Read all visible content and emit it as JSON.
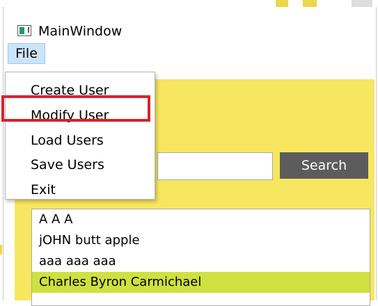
{
  "window": {
    "title": "MainWindow"
  },
  "menubar": {
    "file_label": "File"
  },
  "file_menu": {
    "items": [
      {
        "label": "Create User"
      },
      {
        "label": "Modify User"
      },
      {
        "label": "Load Users"
      },
      {
        "label": "Save Users"
      },
      {
        "label": "Exit"
      }
    ],
    "highlighted_item": "Modify User"
  },
  "search": {
    "value": "",
    "button_label": "Search"
  },
  "users_list": {
    "items": [
      {
        "label": "A A A"
      },
      {
        "label": "jOHN butt apple"
      },
      {
        "label": "aaa aaa aaa"
      },
      {
        "label": "Charles  Byron Carmichael",
        "selected": true
      }
    ]
  },
  "colors": {
    "panel_background": "#f7e65f",
    "selection": "#cfe040",
    "search_button": "#5c5c5c",
    "menu_hover": "#cce4f7",
    "highlight_border": "#d9222a"
  }
}
